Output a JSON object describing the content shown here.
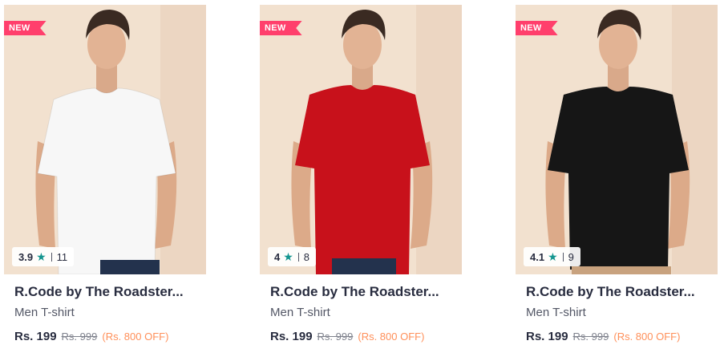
{
  "colors": {
    "badge_bg": "#ff3f6c",
    "star": "#14958f",
    "off_text": "#ff905a",
    "photo_bg": "#f2e1cf"
  },
  "products": [
    {
      "badge": "NEW",
      "rating": "3.9",
      "rating_count": "11",
      "brand": "R.Code by The Roadster...",
      "product": "Men T-shirt",
      "price": "Rs. 199",
      "mrp": "Rs. 999",
      "discount": "(Rs. 800 OFF)",
      "shirt_color": "#f7f7f7"
    },
    {
      "badge": "NEW",
      "rating": "4",
      "rating_count": "8",
      "brand": "R.Code by The Roadster...",
      "product": "Men T-shirt",
      "price": "Rs. 199",
      "mrp": "Rs. 999",
      "discount": "(Rs. 800 OFF)",
      "shirt_color": "#c8111b"
    },
    {
      "badge": "NEW",
      "rating": "4.1",
      "rating_count": "9",
      "brand": "R.Code by The Roadster...",
      "product": "Men T-shirt",
      "price": "Rs. 199",
      "mrp": "Rs. 999",
      "discount": "(Rs. 800 OFF)",
      "shirt_color": "#161616"
    }
  ]
}
